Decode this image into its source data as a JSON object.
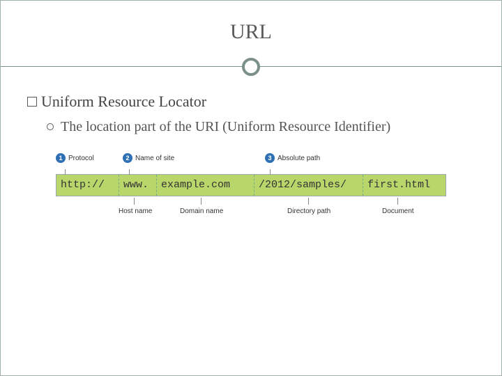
{
  "title": "URL",
  "heading": "Uniform Resource Locator",
  "sub": "The location part of the URI (Uniform Resource Identifier)",
  "diagram": {
    "topLabels": {
      "protocol": "Protocol",
      "site": "Name of site",
      "path": "Absolute path"
    },
    "segments": {
      "protocol": "http://",
      "host": "www.",
      "domain": "example.com",
      "dir": "/2012/samples/",
      "doc": "first.html"
    },
    "bottomLabels": {
      "host": "Host name",
      "domain": "Domain name",
      "dir": "Directory path",
      "doc": "Document"
    },
    "badges": {
      "n1": "1",
      "n2": "2",
      "n3": "3"
    }
  }
}
